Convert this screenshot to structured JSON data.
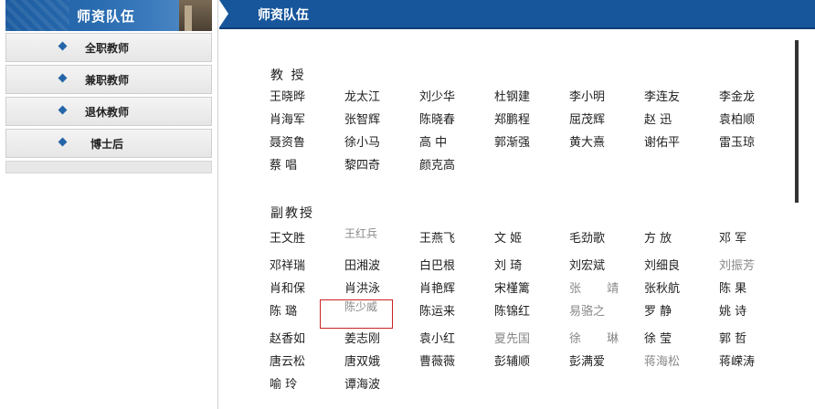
{
  "sidebar": {
    "title": "师资队伍",
    "items": [
      {
        "label": "全职教师"
      },
      {
        "label": "兼职教师"
      },
      {
        "label": "退休教师"
      },
      {
        "label": "博士后"
      }
    ]
  },
  "main": {
    "title": "师资队伍",
    "sections": [
      {
        "title": "教 授",
        "names": [
          "王晓晔",
          "龙太江",
          "刘少华",
          "杜钢建",
          "李小明",
          "李连友",
          "李金龙",
          "肖海军",
          "张智辉",
          "陈晓春",
          "郑鹏程",
          "屈茂辉",
          "赵 迅",
          "袁柏顺",
          "聂资鲁",
          "徐小马",
          "高 中",
          "郭渐强",
          "黄大熹",
          "谢佑平",
          "雷玉琼",
          "蔡 唱",
          "黎四奇",
          "颜克高"
        ]
      },
      {
        "title": "副教授",
        "names": [
          "王文胜",
          "王红兵",
          "王燕飞",
          "文 姬",
          "毛劲歌",
          "方 放",
          "邓 军",
          "邓祥瑞",
          "田湘波",
          "白巴根",
          "刘 琦",
          "刘宏斌",
          "刘细良",
          "刘振芳",
          "肖和保",
          "肖洪泳",
          "肖艳辉",
          "宋槿篱",
          "张 靖",
          "张秋航",
          "陈 果",
          "陈 璐",
          "陈少威",
          "陈运来",
          "陈锦红",
          "易骆之",
          "罗 静",
          "姚 诗",
          "赵香如",
          "姜志刚",
          "袁小红",
          "夏先国",
          "徐 琳",
          "徐 莹",
          "郭 哲",
          "唐云松",
          "唐双娥",
          "曹薇薇",
          "彭辅顺",
          "彭满爱",
          "蒋海松",
          "蒋嵘涛",
          "喻 玲",
          "谭海波"
        ]
      }
    ]
  }
}
